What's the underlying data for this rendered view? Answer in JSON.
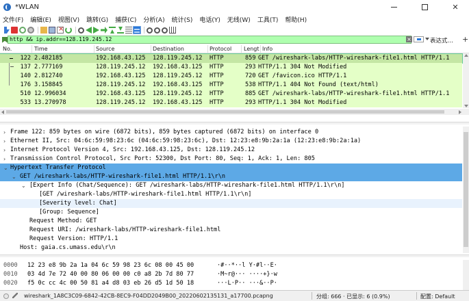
{
  "window": {
    "title": "*WLAN",
    "min_label": "—",
    "max_label": "□",
    "close_label": "✕"
  },
  "menu": [
    "文件(F)",
    "编辑(E)",
    "视图(V)",
    "跳转(G)",
    "捕获(C)",
    "分析(A)",
    "统计(S)",
    "电话(Y)",
    "无线(W)",
    "工具(T)",
    "帮助(H)"
  ],
  "toolbar_icons": [
    "shark-fin-icon",
    "stop-icon",
    "restart-icon",
    "capture-options-icon",
    "open-file-icon",
    "save-file-icon",
    "close-file-icon",
    "reload-icon",
    "find-packet-icon",
    "go-back-icon",
    "go-forward-icon",
    "go-to-packet-icon",
    "first-packet-icon",
    "last-packet-icon",
    "autoscroll-icon",
    "colorize-icon",
    "zoom-in-icon",
    "zoom-out-icon",
    "normal-size-icon",
    "resize-columns-icon"
  ],
  "filter": {
    "value": "http && ip.addr==128.119.245.12",
    "background": "#afffaf",
    "expression_label": "表达式…",
    "plus_label": "+"
  },
  "packet_list": {
    "columns": [
      "No.",
      "Time",
      "Source",
      "Destination",
      "Protocol",
      "Lengt",
      "Info"
    ],
    "row_color": "#e4ffc7",
    "rows": [
      {
        "no": "122",
        "time": "2.482185",
        "src": "192.168.43.125",
        "dst": "128.119.245.12",
        "proto": "HTTP",
        "len": "859",
        "info": "GET /wireshark-labs/HTTP-wireshark-file1.html HTTP/1.1",
        "selected": true
      },
      {
        "no": "137",
        "time": "2.777169",
        "src": "128.119.245.12",
        "dst": "192.168.43.125",
        "proto": "HTTP",
        "len": "293",
        "info": "HTTP/1.1 304 Not Modified",
        "selected": false
      },
      {
        "no": "140",
        "time": "2.812740",
        "src": "192.168.43.125",
        "dst": "128.119.245.12",
        "proto": "HTTP",
        "len": "720",
        "info": "GET /favicon.ico HTTP/1.1",
        "selected": false
      },
      {
        "no": "176",
        "time": "3.158845",
        "src": "128.119.245.12",
        "dst": "192.168.43.125",
        "proto": "HTTP",
        "len": "538",
        "info": "HTTP/1.1 404 Not Found  (text/html)",
        "selected": false
      },
      {
        "no": "510",
        "time": "12.996034",
        "src": "192.168.43.125",
        "dst": "128.119.245.12",
        "proto": "HTTP",
        "len": "885",
        "info": "GET /wireshark-labs/HTTP-wireshark-file1.html HTTP/1.1",
        "selected": false
      },
      {
        "no": "533",
        "time": "13.270978",
        "src": "128.119.245.12",
        "dst": "192.168.43.125",
        "proto": "HTTP",
        "len": "293",
        "info": "HTTP/1.1 304 Not Modified",
        "selected": false
      }
    ]
  },
  "details": [
    {
      "indent": 0,
      "arrow": "›",
      "text": "Frame 122: 859 bytes on wire (6872 bits), 859 bytes captured (6872 bits) on interface 0",
      "hl": ""
    },
    {
      "indent": 0,
      "arrow": "›",
      "text": "Ethernet II, Src: 04:6c:59:98:23:6c (04:6c:59:98:23:6c), Dst: 12:23:e8:9b:2a:1a (12:23:e8:9b:2a:1a)",
      "hl": ""
    },
    {
      "indent": 0,
      "arrow": "›",
      "text": "Internet Protocol Version 4, Src: 192.168.43.125, Dst: 128.119.245.12",
      "hl": ""
    },
    {
      "indent": 0,
      "arrow": "›",
      "text": "Transmission Control Protocol, Src Port: 52300, Dst Port: 80, Seq: 1, Ack: 1, Len: 805",
      "hl": ""
    },
    {
      "indent": 0,
      "arrow": "⌄",
      "text": "Hypertext Transfer Protocol",
      "hl": "hl"
    },
    {
      "indent": 1,
      "arrow": "⌄",
      "text": "GET /wireshark-labs/HTTP-wireshark-file1.html HTTP/1.1\\r\\n",
      "hl": "hl"
    },
    {
      "indent": 2,
      "arrow": "⌄",
      "text": "[Expert Info (Chat/Sequence): GET /wireshark-labs/HTTP-wireshark-file1.html HTTP/1.1\\r\\n]",
      "hl": ""
    },
    {
      "indent": 3,
      "arrow": "",
      "text": "[GET /wireshark-labs/HTTP-wireshark-file1.html HTTP/1.1\\r\\n]",
      "hl": ""
    },
    {
      "indent": 3,
      "arrow": "",
      "text": "[Severity level: Chat]",
      "hl": "hl3"
    },
    {
      "indent": 3,
      "arrow": "",
      "text": "[Group: Sequence]",
      "hl": ""
    },
    {
      "indent": 2,
      "arrow": "",
      "text": "Request Method: GET",
      "hl": ""
    },
    {
      "indent": 2,
      "arrow": "",
      "text": "Request URI: /wireshark-labs/HTTP-wireshark-file1.html",
      "hl": ""
    },
    {
      "indent": 2,
      "arrow": "",
      "text": "Request Version: HTTP/1.1",
      "hl": ""
    },
    {
      "indent": 1,
      "arrow": "",
      "text": "Host: gaia.cs.umass.edu\\r\\n",
      "hl": ""
    }
  ],
  "bytes": [
    {
      "offset": "0000",
      "hex": "12 23 e8 9b 2a 1a 04 6c  59 98 23 6c 08 00 45 00",
      "ascii": "·#··*··l Y·#l··E·"
    },
    {
      "offset": "0010",
      "hex": "03 4d 7e 72 40 00 80 06  00 00 c0 a8 2b 7d 80 77",
      "ascii": "·M~r@··· ····+}·w"
    },
    {
      "offset": "0020",
      "hex": "f5 0c cc 4c 00 50 81 a4  d8 03 eb 26 d5 1d 50 18",
      "ascii": "···L·P·· ···&··P·"
    }
  ],
  "status": {
    "file": "wireshark_1A8C3C09-6842-42CB-8EC9-F04DD2049B00_20220602135131_a17700.pcapng",
    "packets": "分组: 666 · 已显示: 6 (0.9%)",
    "profile": "配置: Default"
  }
}
